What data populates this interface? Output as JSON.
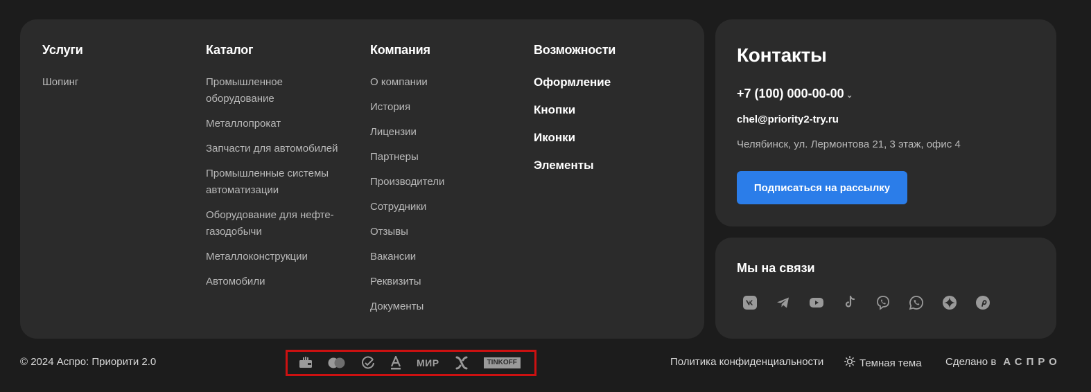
{
  "menu": {
    "services": {
      "title": "Услуги",
      "items": [
        "Шопинг"
      ]
    },
    "catalog": {
      "title": "Каталог",
      "items": [
        "Промышленное оборудование",
        "Металлопрокат",
        "Запчасти для автомобилей",
        "Промышленные системы автоматизации",
        "Оборудование для нефте-газодобычи",
        "Металлоконструкции",
        "Автомобили"
      ]
    },
    "company": {
      "title": "Компания",
      "items": [
        "О компании",
        "История",
        "Лицензии",
        "Партнеры",
        "Производители",
        "Сотрудники",
        "Отзывы",
        "Вакансии",
        "Реквизиты",
        "Документы"
      ]
    },
    "features": {
      "title": "Возможности",
      "items": [
        "Оформление",
        "Кнопки",
        "Иконки",
        "Элементы"
      ]
    }
  },
  "contacts": {
    "title": "Контакты",
    "phone": "+7 (100) 000-00-00",
    "phone_caret": "⌄",
    "email": "chel@priority2-try.ru",
    "address": "Челябинск, ул. Лермонтова 21, 3 этаж, офис 4",
    "subscribe_label": "Подписаться на рассылку"
  },
  "social": {
    "title": "Мы на связи",
    "icons": [
      "vk-icon",
      "telegram-icon",
      "youtube-icon",
      "tiktok-icon",
      "viber-icon",
      "whatsapp-icon",
      "zen-icon",
      "pinterest-icon"
    ]
  },
  "footer": {
    "copyright": "© 2024 Аспро: Приорити 2.0",
    "payments": {
      "mir_label": "МИР",
      "tinkoff_label": "TINKOFF",
      "icons": [
        "wallet-icon",
        "mastercard-icon",
        "sbp-check-icon",
        "alfa-icon",
        "mir-icon",
        "x-pay-icon",
        "tinkoff-icon"
      ]
    },
    "policy": "Политика конфиденциальности",
    "theme": "Темная тема",
    "made_by": "Сделано в",
    "made_by_logo": "АСПРО"
  },
  "colors": {
    "background": "#1c1c1c",
    "panel": "#2b2b2b",
    "accent": "#2b7de9",
    "highlight_border": "#cc1111"
  }
}
